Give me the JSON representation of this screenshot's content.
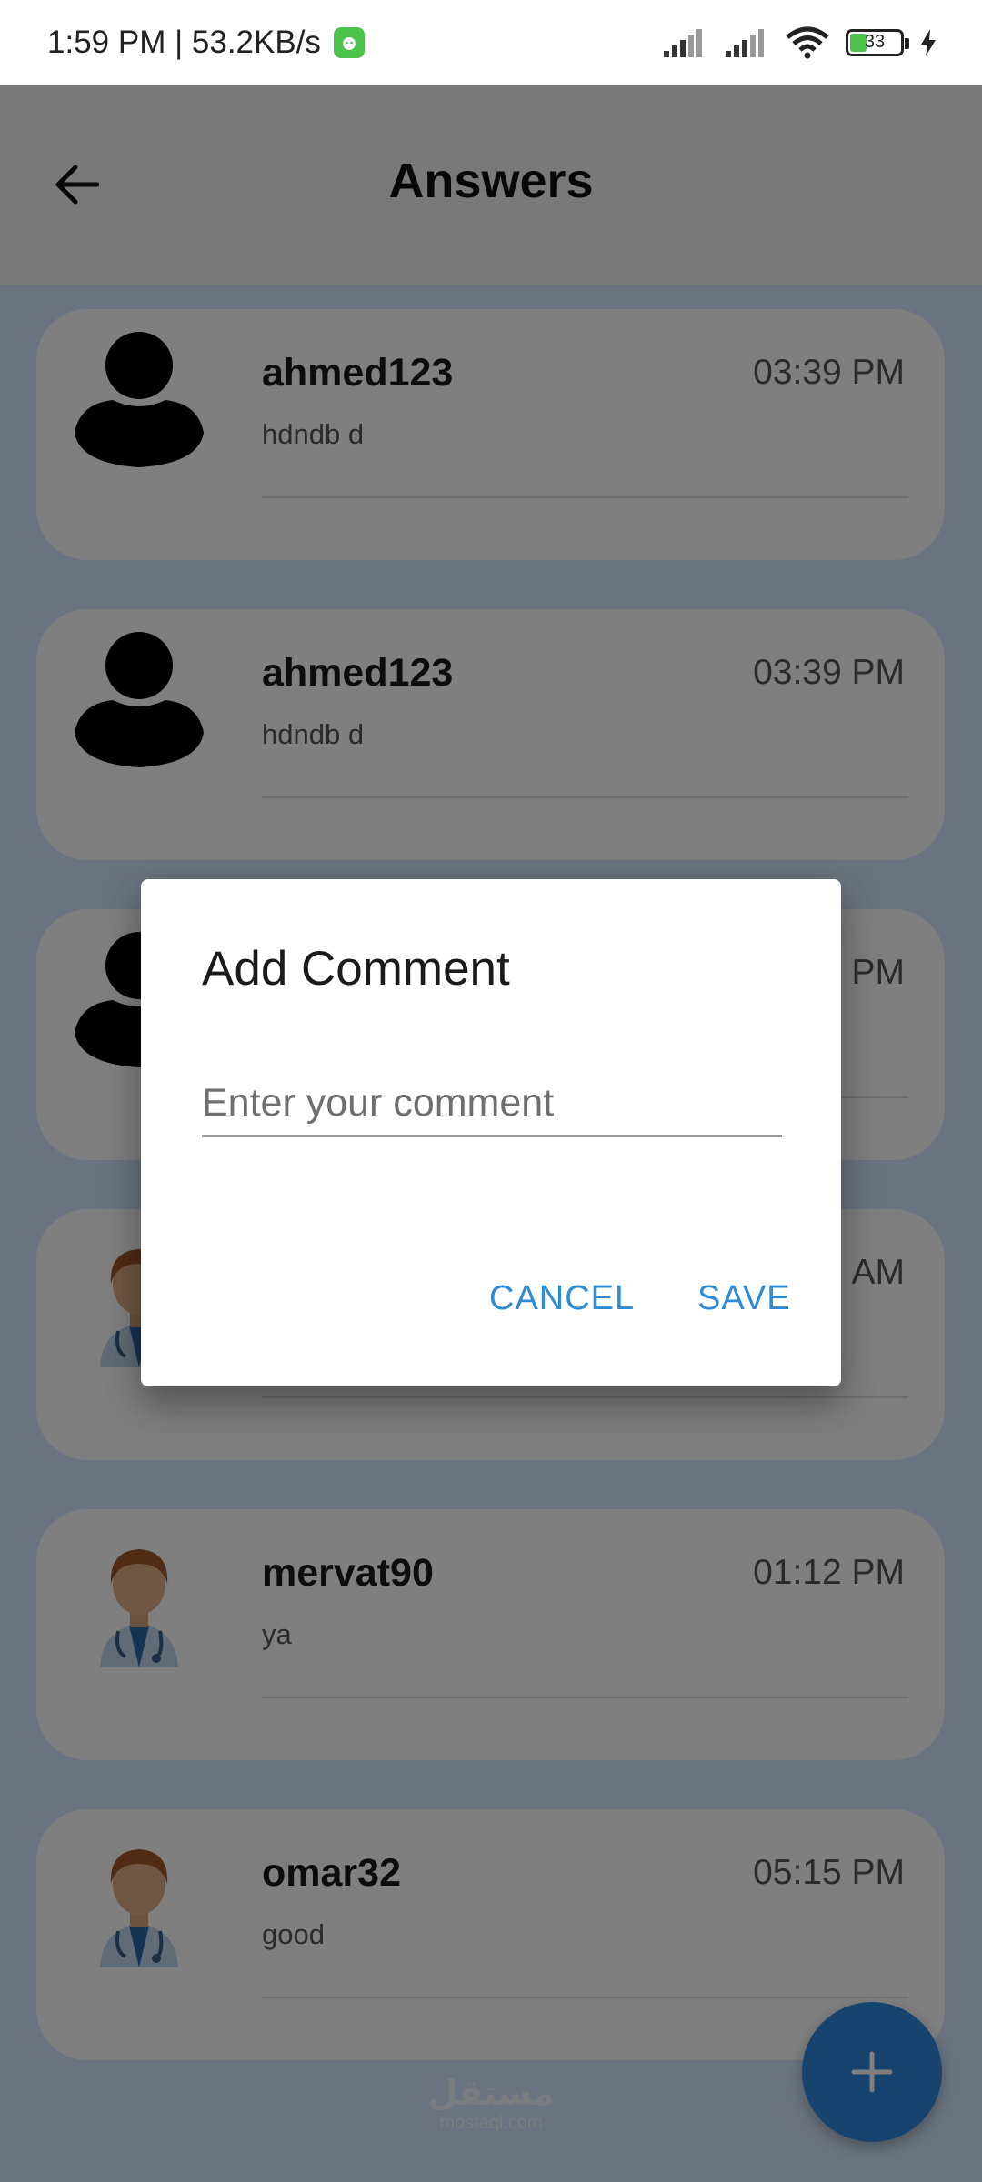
{
  "status_bar": {
    "time_speed": "1:59 PM | 53.2KB/s",
    "battery": "33"
  },
  "app_bar": {
    "title": "Answers",
    "back_icon": "arrow-left-icon"
  },
  "answers": [
    {
      "username": "ahmed123",
      "time": "03:39 PM",
      "comment": "hdndb d",
      "avatar": "person-silhouette-icon"
    },
    {
      "username": "ahmed123",
      "time": "03:39 PM",
      "comment": "hdndb d",
      "avatar": "person-silhouette-icon"
    },
    {
      "username": "",
      "time": "PM",
      "comment": "",
      "avatar": "person-silhouette-icon"
    },
    {
      "username": "",
      "time": "AM",
      "comment": "",
      "avatar": "doctor-avatar-icon"
    },
    {
      "username": "mervat90",
      "time": "01:12 PM",
      "comment": "ya",
      "avatar": "doctor-avatar-icon"
    },
    {
      "username": "omar32",
      "time": "05:15 PM",
      "comment": "good",
      "avatar": "doctor-avatar-icon"
    }
  ],
  "fab": {
    "icon": "plus-icon"
  },
  "watermark": {
    "arabic": "مستقل",
    "latin": "mostaql.com"
  },
  "dialog": {
    "title": "Add Comment",
    "input_placeholder": "Enter your comment",
    "input_value": "",
    "cancel_label": "CANCEL",
    "save_label": "SAVE"
  },
  "colors": {
    "accent": "#2E86DE",
    "list_background": "#D5E7FF",
    "card_background": "#FFFFFF"
  }
}
